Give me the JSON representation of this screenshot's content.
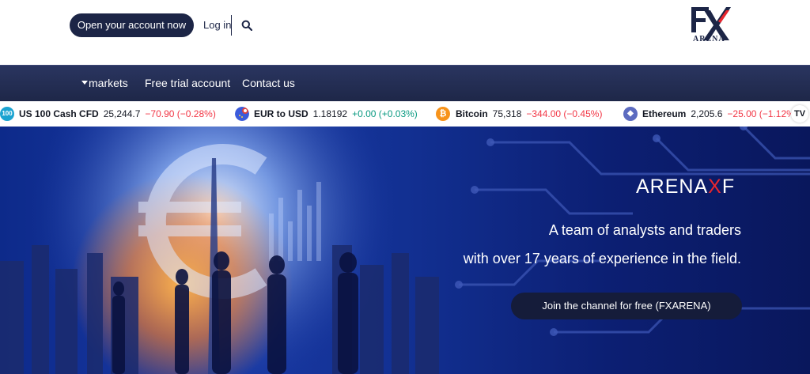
{
  "header": {
    "cta_label": "Open your account now",
    "login_label": "Log in",
    "logo_text": "ARENA"
  },
  "nav": {
    "items": [
      {
        "label": "markets"
      },
      {
        "label": "Free trial account"
      },
      {
        "label": "Contact us"
      }
    ]
  },
  "ticker": {
    "items": [
      {
        "icon_text": "100",
        "name": "US 100 Cash CFD",
        "price": "25,244.7",
        "change": "−70.90 (−0.28%)",
        "direction": "down",
        "icon_color": "#1aa3d1"
      },
      {
        "name": "EUR to USD",
        "price": "1.18192",
        "change": "+0.00 (+0.03%)",
        "direction": "up",
        "icon_color": "#3b5bdb"
      },
      {
        "icon_text": "₿",
        "name": "Bitcoin",
        "price": "75,318",
        "change": "−344.00 (−0.45%)",
        "direction": "down",
        "icon_color": "#f7931a"
      },
      {
        "icon_text": "◆",
        "name": "Ethereum",
        "price": "2,205.6",
        "change": "−25.00 (−1.12%)",
        "direction": "down",
        "icon_color": "#5c6bc0"
      }
    ],
    "tv_logo": "TV"
  },
  "hero": {
    "brand_before": "ARENA",
    "brand_x": "X",
    "brand_after": "F",
    "line1": "A team of analysts and traders",
    "line2": "with over 17 years of experience in the field.",
    "join_label": "Join the channel for free (FXARENA)"
  },
  "colors": {
    "navy": "#1c2546",
    "accent_red": "#e8262e",
    "ticker_up": "#089981",
    "ticker_down": "#f23645"
  }
}
